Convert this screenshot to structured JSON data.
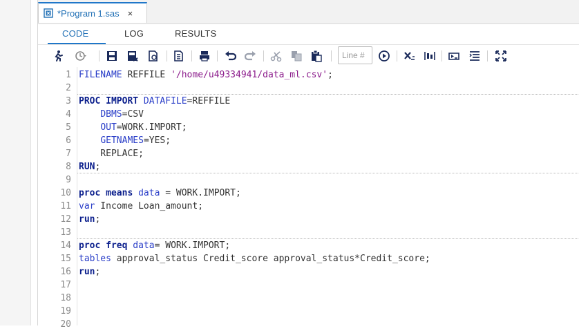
{
  "tab": {
    "title": "*Program 1.sas",
    "close": "×"
  },
  "subtabs": [
    {
      "label": "CODE",
      "active": true
    },
    {
      "label": "LOG",
      "active": false
    },
    {
      "label": "RESULTS",
      "active": false
    }
  ],
  "toolbar": {
    "icons": [
      "run-icon",
      "history-icon",
      "save-icon",
      "save-as-icon",
      "open-icon",
      "copy-submit-icon",
      "print-icon",
      "undo-icon",
      "redo-icon",
      "cut-icon",
      "copy-icon",
      "paste-icon",
      "go-to-line-icon",
      "clear-icon",
      "format-icon",
      "snippet-icon",
      "outline-icon",
      "maximize-icon"
    ],
    "line_placeholder": "Line #"
  },
  "colors": {
    "accent": "#1f77c9",
    "keyword": "#0a1e8c",
    "keyword_light": "#2a3ec8",
    "string": "#8b1a8b",
    "line_number": "#8a8a8a"
  },
  "code": [
    {
      "n": "1",
      "tokens": [
        [
          "kw2",
          "FILENAME"
        ],
        [
          "plain",
          " REFFILE "
        ],
        [
          "str",
          "'/home/u49334941/data_ml.csv'"
        ],
        [
          "plain",
          ";"
        ]
      ]
    },
    {
      "n": "2",
      "tokens": [],
      "sep": true
    },
    {
      "n": "3",
      "tokens": [
        [
          "kw",
          "PROC IMPORT"
        ],
        [
          "plain",
          " "
        ],
        [
          "kw2",
          "DATAFILE"
        ],
        [
          "plain",
          "=REFFILE"
        ]
      ]
    },
    {
      "n": "4",
      "tokens": [
        [
          "plain",
          "    "
        ],
        [
          "kw2",
          "DBMS"
        ],
        [
          "plain",
          "=CSV"
        ]
      ]
    },
    {
      "n": "5",
      "tokens": [
        [
          "plain",
          "    "
        ],
        [
          "kw2",
          "OUT"
        ],
        [
          "plain",
          "=WORK.IMPORT;"
        ]
      ]
    },
    {
      "n": "6",
      "tokens": [
        [
          "plain",
          "    "
        ],
        [
          "kw2",
          "GETNAMES"
        ],
        [
          "plain",
          "=YES;"
        ]
      ]
    },
    {
      "n": "7",
      "tokens": [
        [
          "plain",
          "    REPLACE;"
        ]
      ]
    },
    {
      "n": "8",
      "tokens": [
        [
          "kw",
          "RUN"
        ],
        [
          "plain",
          ";"
        ]
      ],
      "sep": true
    },
    {
      "n": "9",
      "tokens": []
    },
    {
      "n": "10",
      "tokens": [
        [
          "kw",
          "proc means"
        ],
        [
          "plain",
          " "
        ],
        [
          "kw2",
          "data"
        ],
        [
          "plain",
          " = WORK.IMPORT;"
        ]
      ]
    },
    {
      "n": "11",
      "tokens": [
        [
          "kw2",
          "var"
        ],
        [
          "plain",
          " Income Loan_amount;"
        ]
      ]
    },
    {
      "n": "12",
      "tokens": [
        [
          "kw",
          "run"
        ],
        [
          "plain",
          ";"
        ]
      ]
    },
    {
      "n": "13",
      "tokens": [],
      "sep": true
    },
    {
      "n": "14",
      "tokens": [
        [
          "kw",
          "proc freq"
        ],
        [
          "plain",
          " "
        ],
        [
          "kw2",
          "data"
        ],
        [
          "plain",
          "= WORK.IMPORT;"
        ]
      ]
    },
    {
      "n": "15",
      "tokens": [
        [
          "kw2",
          "tables"
        ],
        [
          "plain",
          " approval_status Credit_score approval_status*Credit_score;"
        ]
      ]
    },
    {
      "n": "16",
      "tokens": [
        [
          "kw",
          "run"
        ],
        [
          "plain",
          ";"
        ]
      ]
    },
    {
      "n": "17",
      "tokens": []
    },
    {
      "n": "18",
      "tokens": []
    },
    {
      "n": "19",
      "tokens": []
    },
    {
      "n": "20",
      "tokens": []
    }
  ]
}
